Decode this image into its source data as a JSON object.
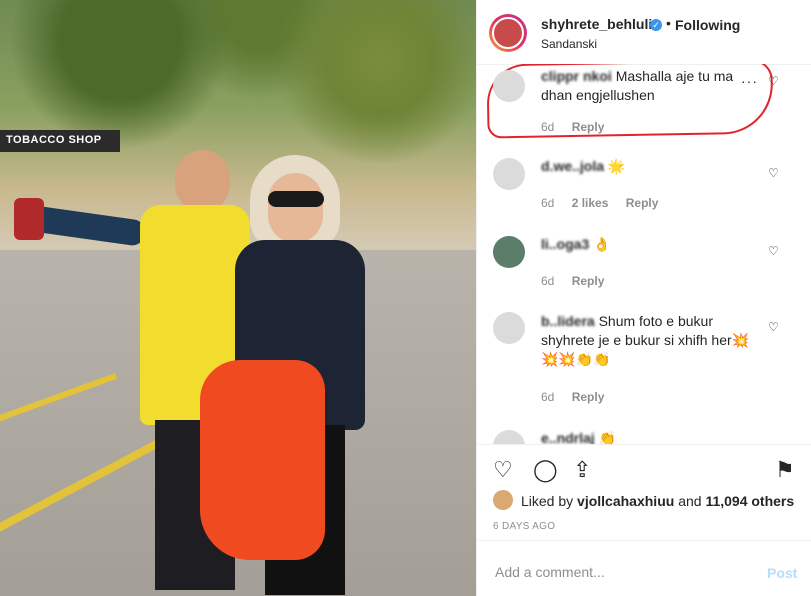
{
  "photo": {
    "shop_sign": "TOBACCO SHOP"
  },
  "header": {
    "username": "shyhrete_behluli",
    "separator": "•",
    "follow_status": "Following",
    "location": "Sandanski"
  },
  "comments": [
    {
      "user": "clippr nkoi",
      "text": "Mashalla aje tu ma dhan engjellushen",
      "time": "6d",
      "likes": "",
      "reply": "Reply"
    },
    {
      "user": "d.we..jola",
      "text": "🌟",
      "time": "6d",
      "likes": "2 likes",
      "reply": "Reply"
    },
    {
      "user": "li..oga3",
      "text": "👌",
      "time": "6d",
      "likes": "",
      "reply": "Reply"
    },
    {
      "user": "b..lidera",
      "text": "Shum foto e bukur shyhrete je e bukur si xhifh her💥 💥💥👏👏",
      "time": "6d",
      "likes": "",
      "reply": "Reply"
    },
    {
      "user": "e..ndrlaj",
      "text": "👏",
      "time": "",
      "likes": "",
      "reply": ""
    }
  ],
  "likes": {
    "prefix": "Liked by",
    "user": "vjollcahaxhiuu",
    "joiner": "and",
    "others": "11,094 others"
  },
  "date": "6 DAYS AGO",
  "add_comment": {
    "placeholder": "Add a comment...",
    "post_label": "Post"
  },
  "colors": {
    "annotation": "#e0242c",
    "verified": "#3897f0",
    "post_disabled": "#b2dffc"
  }
}
